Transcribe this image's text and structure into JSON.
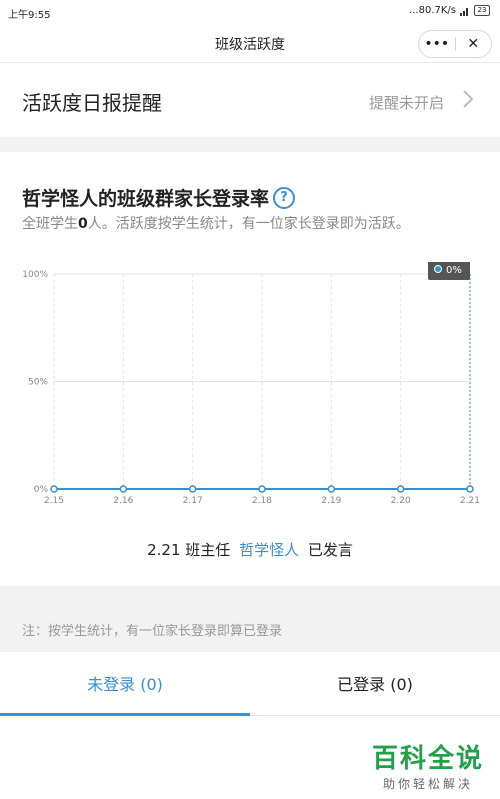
{
  "status_bar": {
    "time": "上午9:55",
    "network": "...80.7K/s",
    "battery": "23"
  },
  "title_bar": {
    "title": "班级活跃度",
    "more_label": "•••",
    "close_label": "✕"
  },
  "reminder": {
    "label": "活跃度日报提醒",
    "status": "提醒未开启"
  },
  "card": {
    "title": "哲学怪人的班级群家长登录率",
    "help_label": "?",
    "desc_prefix": "全班学生",
    "desc_count": "0",
    "desc_suffix": "人。活跃度按学生统计，有一位家长登录即为活跃。"
  },
  "chart_data": {
    "type": "line",
    "categories": [
      "2.15",
      "2.16",
      "2.17",
      "2.18",
      "2.19",
      "2.20",
      "2.21"
    ],
    "series": [
      {
        "values": [
          0,
          0,
          0,
          0,
          0,
          0,
          0
        ]
      }
    ],
    "y_ticks": [
      "100%",
      "50%",
      "0%"
    ],
    "ylim": [
      0,
      100
    ],
    "tooltip": {
      "category": "2.21",
      "label": "0%"
    },
    "grid": true,
    "colors": {
      "line": "#3a8fd0",
      "grid": "#e3e3e3",
      "tooltip_bg": "#555555"
    }
  },
  "speaker": {
    "date": "2.21",
    "role": "班主任",
    "name": "哲学怪人",
    "action": "已发言"
  },
  "note": "注：按学生统计，有一位家长登录即算已登录",
  "tabs": [
    {
      "label": "未登录 (0)",
      "active": true
    },
    {
      "label": "已登录 (0)",
      "active": false
    }
  ],
  "watermark": {
    "logo": "百科全说",
    "sub": "助你轻松解决"
  }
}
